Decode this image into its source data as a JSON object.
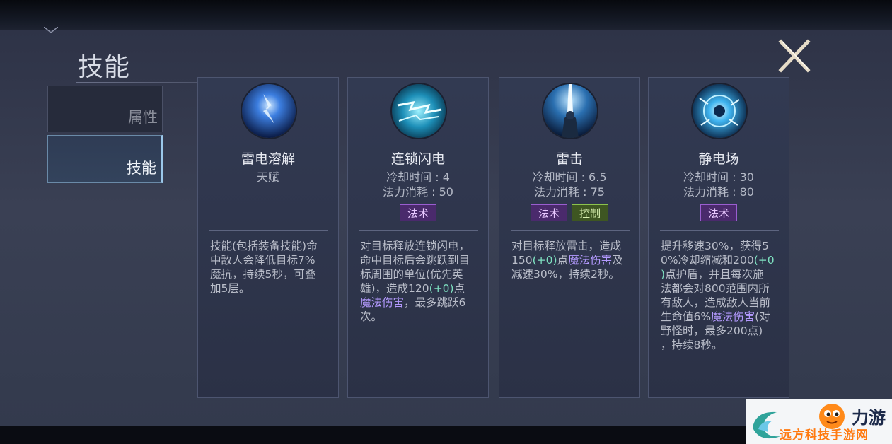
{
  "page": {
    "title": "技能",
    "close_label": "X"
  },
  "sidebar": {
    "tabs": [
      {
        "label": "属性",
        "active": false
      },
      {
        "label": "技能",
        "active": true
      }
    ]
  },
  "skills": [
    {
      "name": "雷电溶解",
      "subtitle": "天赋",
      "icon": "lightning-orb-icon",
      "description": [
        "技能(包括装备技能)命",
        "中敌人会降低目标7%",
        "魔抗，持续5秒，可叠",
        "加5层。"
      ]
    },
    {
      "name": "连锁闪电",
      "cooldown": "冷却时间 : 4",
      "mana": "法力消耗 : 50",
      "tags": [
        "法术"
      ],
      "icon": "chain-lightning-icon",
      "description": {
        "l1": "对目标释放连锁闪电，",
        "l2": "命中目标后会跳跃到目",
        "l3": "标周围的单位(优先英",
        "l4a": "雄)，造成120",
        "l4b": "(+0)",
        "l4c": "点",
        "l5a": "魔法伤害",
        "l5b": "，最多跳跃6",
        "l6": "次。"
      }
    },
    {
      "name": "雷击",
      "cooldown": "冷却时间 : 6.5",
      "mana": "法力消耗 : 75",
      "tags": [
        "法术",
        "控制"
      ],
      "icon": "thunder-strike-icon",
      "description": {
        "l1": "对目标释放雷击，造成",
        "l2a": "150",
        "l2b": "(+0)",
        "l2c": "点",
        "l2d": "魔法伤害",
        "l2e": "及",
        "l3": "减速30%，持续2秒。"
      }
    },
    {
      "name": "静电场",
      "cooldown": "冷却时间 : 30",
      "mana": "法力消耗 : 80",
      "tags": [
        "法术"
      ],
      "icon": "static-field-icon",
      "description": {
        "l1": "提升移速30%，获得5",
        "l2a": "0%冷却缩减和200",
        "l2b": "(+0",
        "l3a": ")",
        "l3b": "点护盾，并且每次施",
        "l4": "法都会对800范围内所",
        "l5": "有敌人，造成敌人当前",
        "l6a": "生命值6%",
        "l6b": "魔法伤害",
        "l6c": "(对",
        "l7": "野怪时，最多200点)",
        "l8": "，持续8秒。"
      }
    }
  ],
  "watermark": {
    "brand": "力游",
    "site": "远方科技手游网"
  }
}
